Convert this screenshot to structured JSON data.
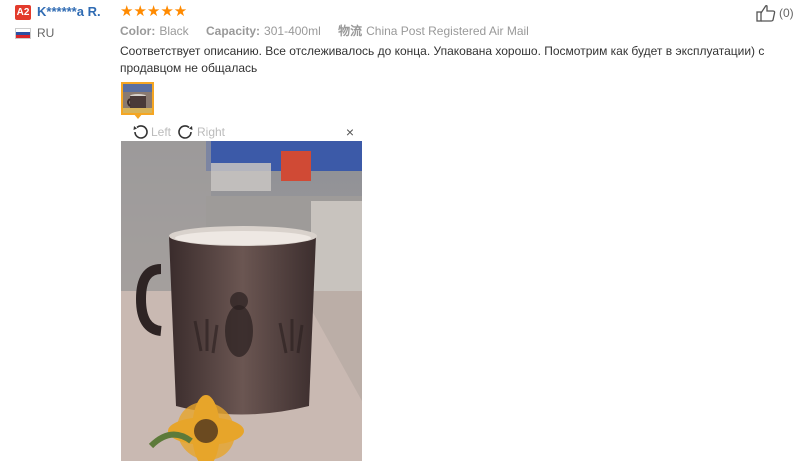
{
  "review": {
    "avatar_initials": "A2",
    "username": "K******a R.",
    "country": "RU",
    "flag_colors": [
      "#ffffff",
      "#2b4fa3",
      "#d9252a"
    ],
    "stars": "★★★★★",
    "rating": 5,
    "star_color": "#ff8a00",
    "meta": {
      "color_label": "Color:",
      "color_value": "Black",
      "capacity_label": "Capacity:",
      "capacity_value": "301-400ml",
      "shipping_label": "物流",
      "shipping_value": "China Post Registered Air Mail"
    },
    "text": "Соответствует описанию. Все отслеживалось до конца. Упакована хорошо. Посмотрим как будет в эксплуатации) с продавцом не общалась",
    "likes": "(0)"
  },
  "viewer": {
    "rotate_left_label": "Left",
    "rotate_right_label": "Right",
    "close_label": "×"
  },
  "icons": {
    "like": "thumbs-up-icon",
    "rotate_left": "rotate-left-icon",
    "rotate_right": "rotate-right-icon",
    "close": "close-icon"
  }
}
